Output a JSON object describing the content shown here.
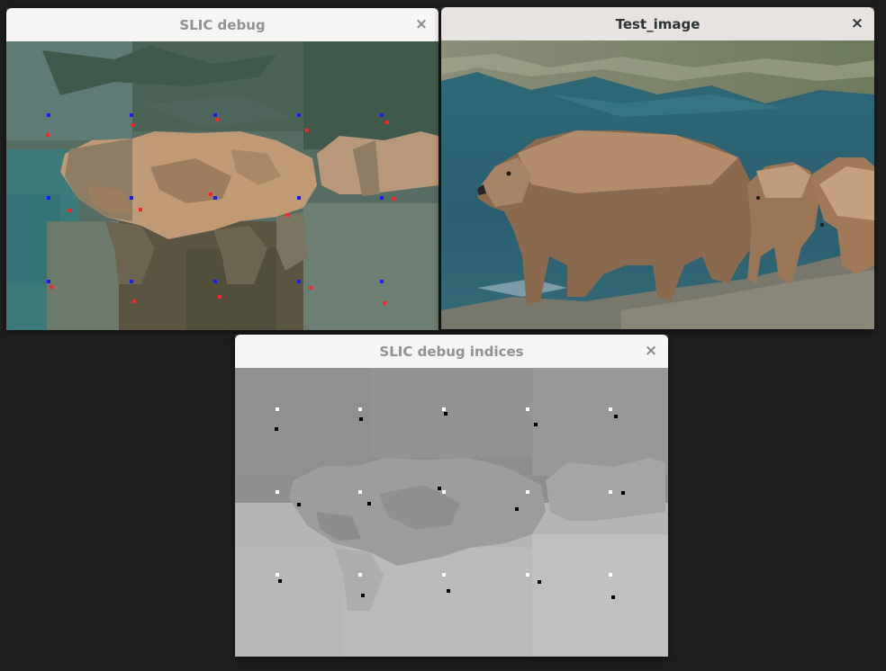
{
  "windows": {
    "slic_debug": {
      "title": "SLIC debug",
      "close_glyph": "×"
    },
    "test_image": {
      "title": "Test_image",
      "close_glyph": "×"
    },
    "slic_indices": {
      "title": "SLIC debug indices",
      "close_glyph": "×"
    }
  },
  "colors": {
    "desktop": "#1f1f1f",
    "blue_marker": "#1a1aff",
    "red_marker": "#ff2222",
    "white_marker": "#ffffff",
    "black_marker": "#000000"
  }
}
